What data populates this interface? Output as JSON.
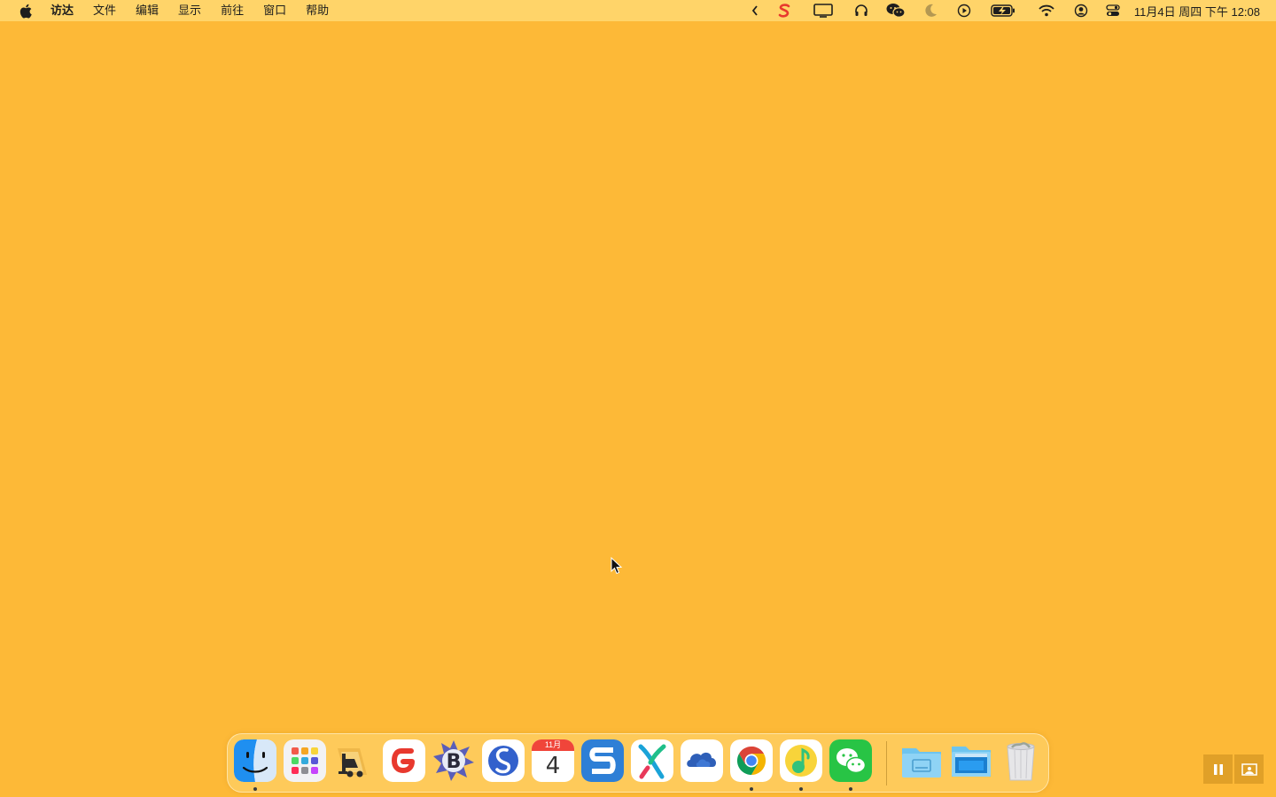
{
  "menubar": {
    "app_name": "访达",
    "menus": [
      "文件",
      "编辑",
      "显示",
      "前往",
      "窗口",
      "帮助"
    ],
    "status_icons": [
      "chevron-left-icon",
      "sogou-input-icon",
      "display-icon",
      "headphones-icon",
      "wechat-icon",
      "moon-icon",
      "play-circle-icon",
      "battery-charging-icon",
      "wifi-icon",
      "user-icon",
      "control-center-icon"
    ],
    "clock": "11月4日 周四 下午 12:08"
  },
  "desktop": {
    "background_color": "#FDB937"
  },
  "dock": {
    "apps": [
      {
        "name": "finder",
        "running": true
      },
      {
        "name": "launchpad",
        "running": false
      },
      {
        "name": "forklift",
        "running": false
      },
      {
        "name": "gitmind",
        "running": false
      },
      {
        "name": "bbedit",
        "running": false
      },
      {
        "name": "simplenote",
        "running": false
      },
      {
        "name": "calendar",
        "running": false,
        "month": "11月",
        "day": "4"
      },
      {
        "name": "sogou",
        "running": false
      },
      {
        "name": "xmind",
        "running": false
      },
      {
        "name": "onedrive",
        "running": false
      },
      {
        "name": "chrome",
        "running": true
      },
      {
        "name": "qq-music",
        "running": true
      },
      {
        "name": "wechat",
        "running": true
      }
    ],
    "stacks": [
      "documents-folder",
      "downloads-folder",
      "trash"
    ]
  },
  "recorder_controls": [
    "pause-icon",
    "picture-icon"
  ]
}
